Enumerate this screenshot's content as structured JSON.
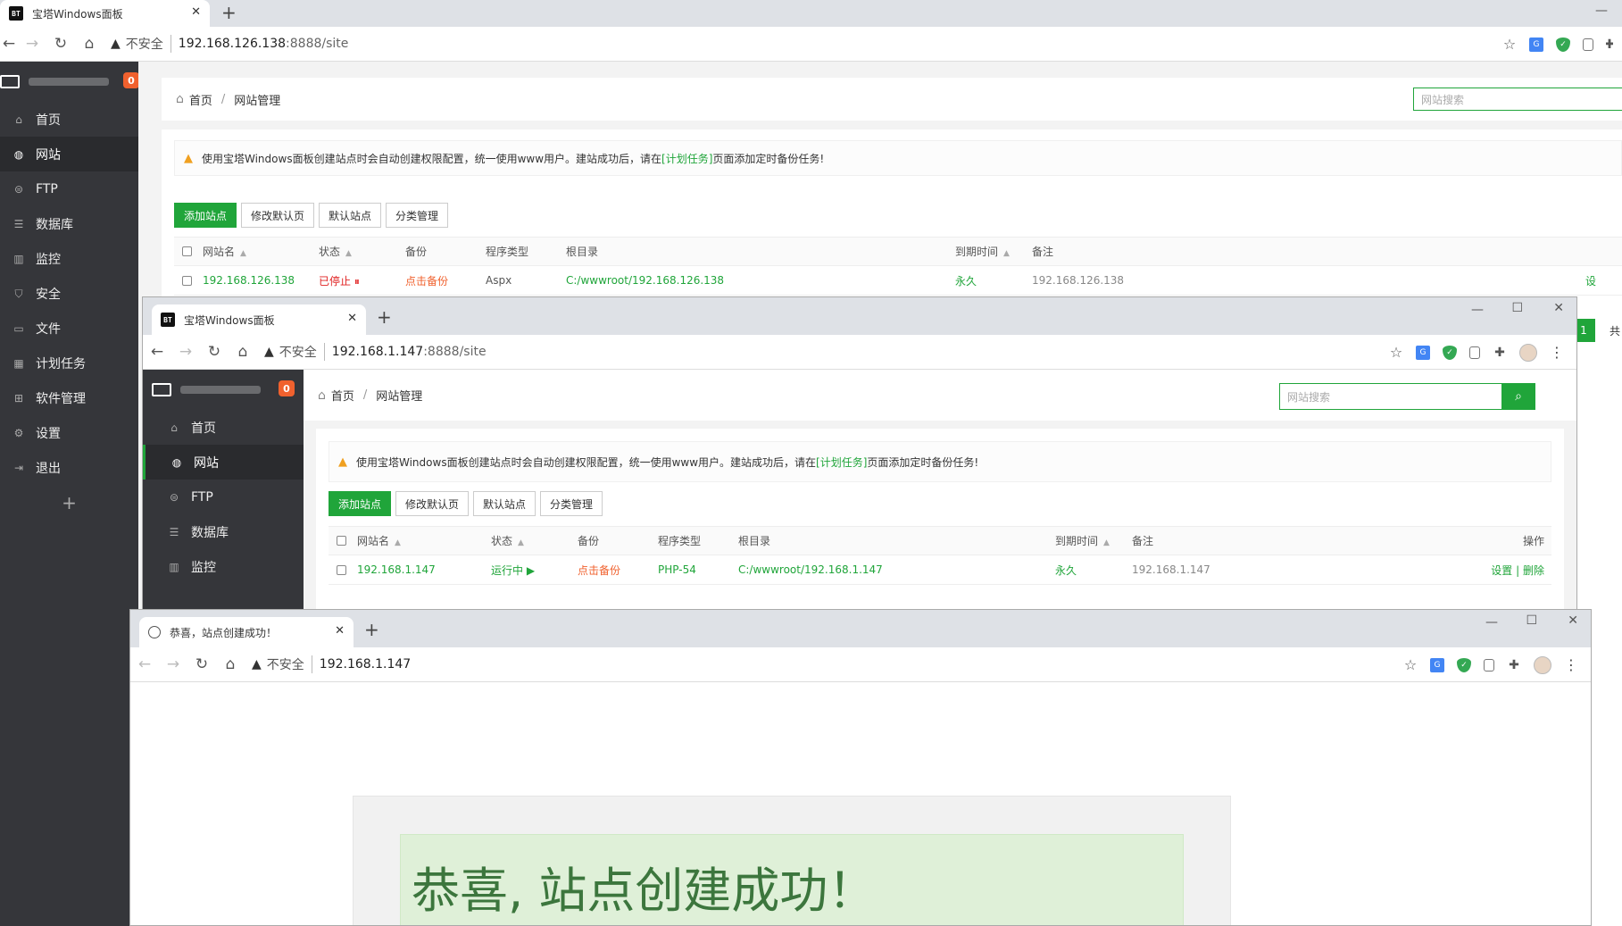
{
  "window1": {
    "tab_title": "宝塔Windows面板",
    "favicon": "BT",
    "url_host": "192.168.126.138",
    "url_path": ":8888/site",
    "insecure_label": "不安全",
    "badge": "0",
    "sidebar": [
      "首页",
      "网站",
      "FTP",
      "数据库",
      "监控",
      "安全",
      "文件",
      "计划任务",
      "软件管理",
      "设置",
      "退出"
    ],
    "crumb_home": "首页",
    "crumb_current": "网站管理",
    "search_placeholder": "网站搜索",
    "notice_prefix": "使用宝塔Windows面板创建站点时会自动创建权限配置，统一使用www用户。建站成功后，请在",
    "notice_link": "[计划任务]",
    "notice_suffix": "页面添加定时备份任务!",
    "buttons": [
      "添加站点",
      "修改默认页",
      "默认站点",
      "分类管理"
    ],
    "headers": [
      "网站名",
      "状态",
      "备份",
      "程序类型",
      "根目录",
      "到期时间",
      "备注"
    ],
    "row": {
      "name": "192.168.126.138",
      "status": "已停止",
      "status_icon": "⏸",
      "backup": "点击备份",
      "type": "Aspx",
      "root": "C:/wwwroot/192.168.126.138",
      "expire": "永久",
      "note": "192.168.126.138",
      "action": "设"
    },
    "page_current": "1",
    "page_total_prefix": "共"
  },
  "window2": {
    "tab_title": "宝塔Windows面板",
    "favicon": "BT",
    "url_host": "192.168.1.147",
    "url_path": ":8888/site",
    "insecure_label": "不安全",
    "badge": "0",
    "sidebar": [
      "首页",
      "网站",
      "FTP",
      "数据库",
      "监控"
    ],
    "crumb_home": "首页",
    "crumb_current": "网站管理",
    "search_placeholder": "网站搜索",
    "notice_prefix": "使用宝塔Windows面板创建站点时会自动创建权限配置，统一使用www用户。建站成功后，请在",
    "notice_link": "[计划任务]",
    "notice_suffix": "页面添加定时备份任务!",
    "buttons": [
      "添加站点",
      "修改默认页",
      "默认站点",
      "分类管理"
    ],
    "headers": [
      "网站名",
      "状态",
      "备份",
      "程序类型",
      "根目录",
      "到期时间",
      "备注",
      "操作"
    ],
    "row": {
      "name": "192.168.1.147",
      "status": "运行中",
      "status_icon": "▶",
      "backup": "点击备份",
      "type": "PHP-54",
      "root": "C:/wwwroot/192.168.1.147",
      "expire": "永久",
      "note": "192.168.1.147",
      "action_set": "设置",
      "action_sep": "|",
      "action_del": "删除"
    }
  },
  "window3": {
    "tab_title": "恭喜，站点创建成功！",
    "url_host": "192.168.1.147",
    "insecure_label": "不安全",
    "congrats": "恭喜, 站点创建成功！"
  },
  "icons": {
    "back": "back-arrow-icon",
    "forward": "forward-arrow-icon",
    "reload": "reload-icon",
    "home": "home-icon",
    "warning": "warning-icon",
    "star": "bookmark-star-icon",
    "translate": "google-translate-icon",
    "shield": "shield-extension-icon",
    "extension": "extension-icon",
    "puzzle": "puzzle-icon",
    "avatar": "profile-avatar",
    "menu": "kebab-menu-icon"
  },
  "colors": {
    "accent": "#20a53a",
    "sidebar": "#35363a",
    "badge": "#f0612e",
    "stopped": "#e02020"
  }
}
